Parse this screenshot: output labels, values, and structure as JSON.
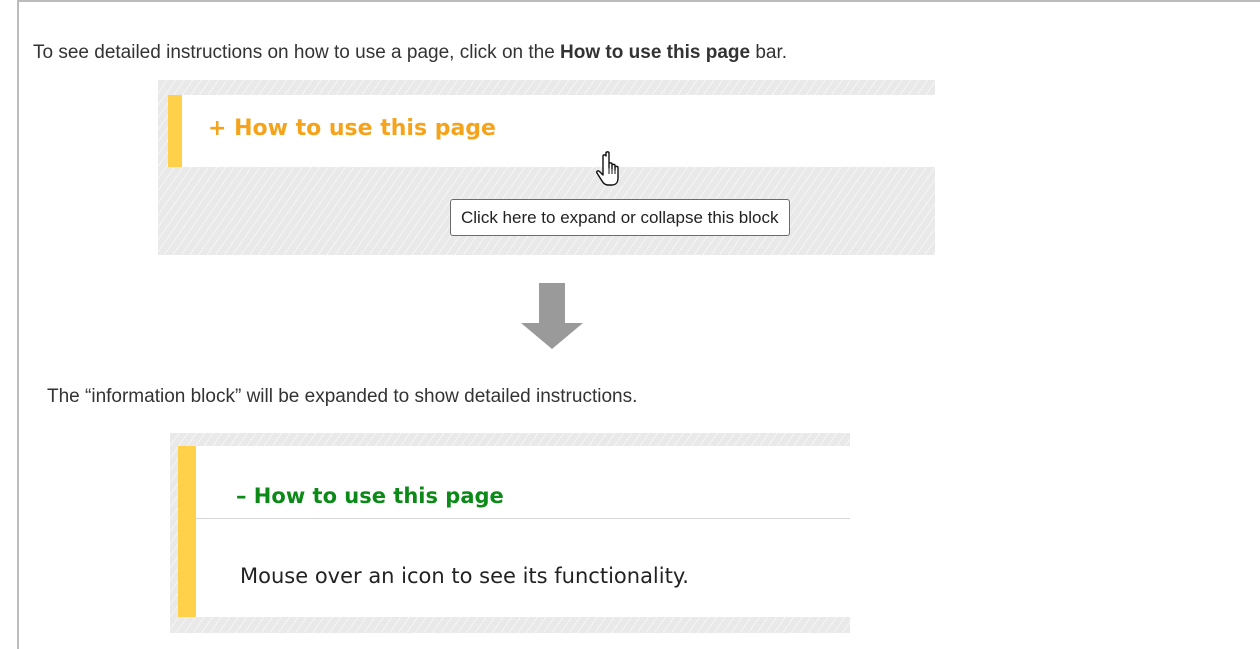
{
  "intro": {
    "text_before": "To see detailed instructions on how to use a page, click on the ",
    "bold": "How to use this page",
    "text_after": " bar."
  },
  "collapsed_bar": {
    "title": "+ How to use this page",
    "tooltip": "Click here to expand or collapse this block"
  },
  "outro": {
    "text": "The “information block” will be expanded to show detailed instructions."
  },
  "expanded_block": {
    "title": "– How to use this page",
    "body": "Mouse over an icon to see its functionality."
  },
  "colors": {
    "accent_bar": "#ffd04a",
    "collapsed_title": "#f5a31a",
    "expanded_title": "#0b8a18",
    "arrow": "#9a9a9a"
  },
  "icons": {
    "cursor": "hand-pointer-icon",
    "arrow": "down-arrow-icon"
  }
}
